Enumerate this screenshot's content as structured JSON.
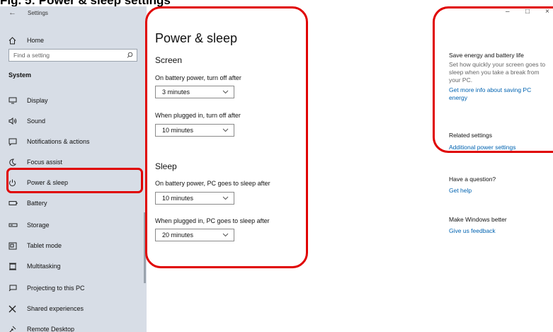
{
  "figure_title": "Fig. 5: Power & sleep settings",
  "window": {
    "title": "Settings",
    "controls": {
      "minimize": "–",
      "maximize": "□",
      "close": "×"
    }
  },
  "sidebar": {
    "home_label": "Home",
    "search_placeholder": "Find a setting",
    "group_label": "System",
    "items": [
      {
        "label": "Display",
        "icon": "monitor-icon"
      },
      {
        "label": "Sound",
        "icon": "speaker-icon"
      },
      {
        "label": "Notifications & actions",
        "icon": "notification-icon"
      },
      {
        "label": "Focus assist",
        "icon": "moon-icon"
      },
      {
        "label": "Power & sleep",
        "icon": "power-icon",
        "selected": true
      },
      {
        "label": "Battery",
        "icon": "battery-icon"
      },
      {
        "label": "Storage",
        "icon": "storage-icon"
      },
      {
        "label": "Tablet mode",
        "icon": "tablet-icon"
      },
      {
        "label": "Multitasking",
        "icon": "multitasking-icon"
      },
      {
        "label": "Projecting to this PC",
        "icon": "projector-icon"
      },
      {
        "label": "Shared experiences",
        "icon": "shared-icon"
      },
      {
        "label": "Remote Desktop",
        "icon": "remote-desktop-icon"
      }
    ]
  },
  "main": {
    "title": "Power & sleep",
    "screen": {
      "heading": "Screen",
      "battery_label": "On battery power, turn off after",
      "battery_value": "3 minutes",
      "plugged_label": "When plugged in, turn off after",
      "plugged_value": "10 minutes"
    },
    "sleep": {
      "heading": "Sleep",
      "battery_label": "On battery power, PC goes to sleep after",
      "battery_value": "10 minutes",
      "plugged_label": "When plugged in, PC goes to sleep after",
      "plugged_value": "20 minutes"
    }
  },
  "right": {
    "save_heading": "Save energy and battery life",
    "save_text": "Set how quickly your screen goes to sleep when you take a break from your PC.",
    "save_link": "Get more info about saving PC energy",
    "related_heading": "Related settings",
    "related_link": "Additional power settings",
    "question_heading": "Have a question?",
    "question_link": "Get help",
    "better_heading": "Make Windows better",
    "better_link": "Give us feedback"
  },
  "colors": {
    "highlight_outline": "#e00000",
    "link": "#0063b1",
    "sidebar_bg": "#d7dde6"
  }
}
